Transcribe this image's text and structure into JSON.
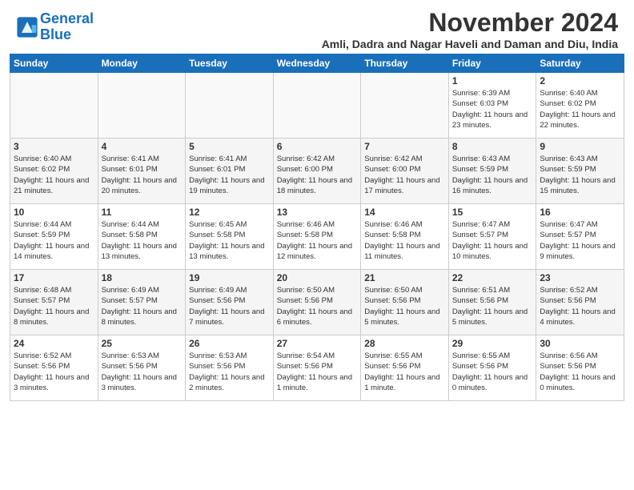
{
  "header": {
    "logo_general": "General",
    "logo_blue": "Blue",
    "month_title": "November 2024",
    "subtitle": "Amli, Dadra and Nagar Haveli and Daman and Diu, India"
  },
  "weekdays": [
    "Sunday",
    "Monday",
    "Tuesday",
    "Wednesday",
    "Thursday",
    "Friday",
    "Saturday"
  ],
  "weeks": [
    [
      {
        "day": "",
        "info": ""
      },
      {
        "day": "",
        "info": ""
      },
      {
        "day": "",
        "info": ""
      },
      {
        "day": "",
        "info": ""
      },
      {
        "day": "",
        "info": ""
      },
      {
        "day": "1",
        "info": "Sunrise: 6:39 AM\nSunset: 6:03 PM\nDaylight: 11 hours and 23 minutes."
      },
      {
        "day": "2",
        "info": "Sunrise: 6:40 AM\nSunset: 6:02 PM\nDaylight: 11 hours and 22 minutes."
      }
    ],
    [
      {
        "day": "3",
        "info": "Sunrise: 6:40 AM\nSunset: 6:02 PM\nDaylight: 11 hours and 21 minutes."
      },
      {
        "day": "4",
        "info": "Sunrise: 6:41 AM\nSunset: 6:01 PM\nDaylight: 11 hours and 20 minutes."
      },
      {
        "day": "5",
        "info": "Sunrise: 6:41 AM\nSunset: 6:01 PM\nDaylight: 11 hours and 19 minutes."
      },
      {
        "day": "6",
        "info": "Sunrise: 6:42 AM\nSunset: 6:00 PM\nDaylight: 11 hours and 18 minutes."
      },
      {
        "day": "7",
        "info": "Sunrise: 6:42 AM\nSunset: 6:00 PM\nDaylight: 11 hours and 17 minutes."
      },
      {
        "day": "8",
        "info": "Sunrise: 6:43 AM\nSunset: 5:59 PM\nDaylight: 11 hours and 16 minutes."
      },
      {
        "day": "9",
        "info": "Sunrise: 6:43 AM\nSunset: 5:59 PM\nDaylight: 11 hours and 15 minutes."
      }
    ],
    [
      {
        "day": "10",
        "info": "Sunrise: 6:44 AM\nSunset: 5:59 PM\nDaylight: 11 hours and 14 minutes."
      },
      {
        "day": "11",
        "info": "Sunrise: 6:44 AM\nSunset: 5:58 PM\nDaylight: 11 hours and 13 minutes."
      },
      {
        "day": "12",
        "info": "Sunrise: 6:45 AM\nSunset: 5:58 PM\nDaylight: 11 hours and 13 minutes."
      },
      {
        "day": "13",
        "info": "Sunrise: 6:46 AM\nSunset: 5:58 PM\nDaylight: 11 hours and 12 minutes."
      },
      {
        "day": "14",
        "info": "Sunrise: 6:46 AM\nSunset: 5:58 PM\nDaylight: 11 hours and 11 minutes."
      },
      {
        "day": "15",
        "info": "Sunrise: 6:47 AM\nSunset: 5:57 PM\nDaylight: 11 hours and 10 minutes."
      },
      {
        "day": "16",
        "info": "Sunrise: 6:47 AM\nSunset: 5:57 PM\nDaylight: 11 hours and 9 minutes."
      }
    ],
    [
      {
        "day": "17",
        "info": "Sunrise: 6:48 AM\nSunset: 5:57 PM\nDaylight: 11 hours and 8 minutes."
      },
      {
        "day": "18",
        "info": "Sunrise: 6:49 AM\nSunset: 5:57 PM\nDaylight: 11 hours and 8 minutes."
      },
      {
        "day": "19",
        "info": "Sunrise: 6:49 AM\nSunset: 5:56 PM\nDaylight: 11 hours and 7 minutes."
      },
      {
        "day": "20",
        "info": "Sunrise: 6:50 AM\nSunset: 5:56 PM\nDaylight: 11 hours and 6 minutes."
      },
      {
        "day": "21",
        "info": "Sunrise: 6:50 AM\nSunset: 5:56 PM\nDaylight: 11 hours and 5 minutes."
      },
      {
        "day": "22",
        "info": "Sunrise: 6:51 AM\nSunset: 5:56 PM\nDaylight: 11 hours and 5 minutes."
      },
      {
        "day": "23",
        "info": "Sunrise: 6:52 AM\nSunset: 5:56 PM\nDaylight: 11 hours and 4 minutes."
      }
    ],
    [
      {
        "day": "24",
        "info": "Sunrise: 6:52 AM\nSunset: 5:56 PM\nDaylight: 11 hours and 3 minutes."
      },
      {
        "day": "25",
        "info": "Sunrise: 6:53 AM\nSunset: 5:56 PM\nDaylight: 11 hours and 3 minutes."
      },
      {
        "day": "26",
        "info": "Sunrise: 6:53 AM\nSunset: 5:56 PM\nDaylight: 11 hours and 2 minutes."
      },
      {
        "day": "27",
        "info": "Sunrise: 6:54 AM\nSunset: 5:56 PM\nDaylight: 11 hours and 1 minute."
      },
      {
        "day": "28",
        "info": "Sunrise: 6:55 AM\nSunset: 5:56 PM\nDaylight: 11 hours and 1 minute."
      },
      {
        "day": "29",
        "info": "Sunrise: 6:55 AM\nSunset: 5:56 PM\nDaylight: 11 hours and 0 minutes."
      },
      {
        "day": "30",
        "info": "Sunrise: 6:56 AM\nSunset: 5:56 PM\nDaylight: 11 hours and 0 minutes."
      }
    ]
  ]
}
